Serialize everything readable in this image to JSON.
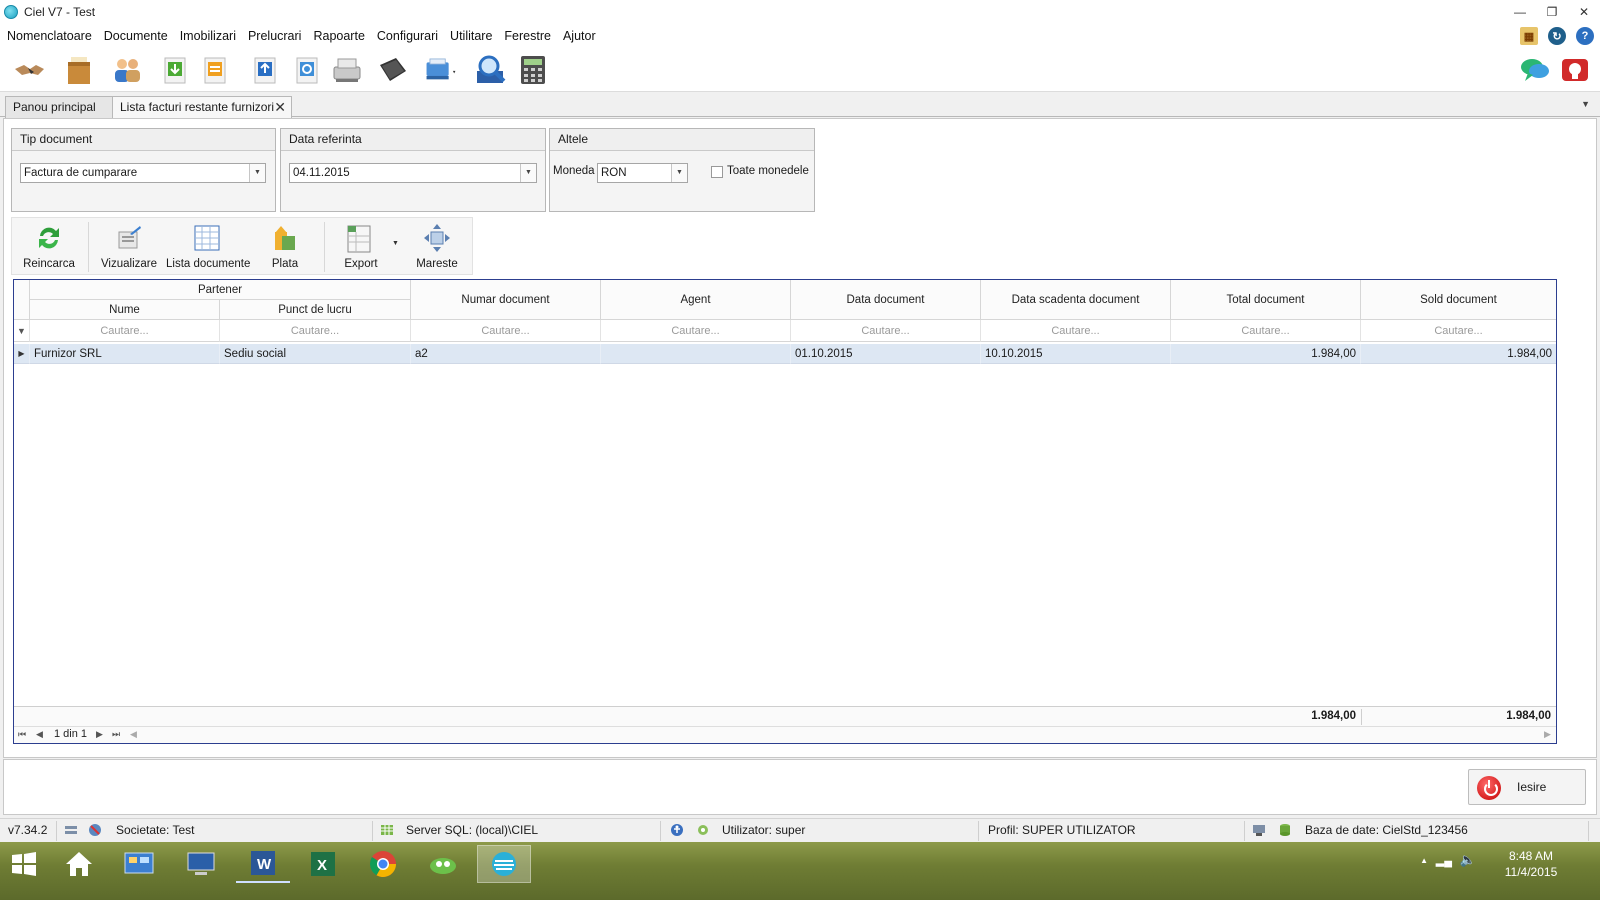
{
  "window": {
    "title": "Ciel V7 - Test"
  },
  "menu": [
    "Nomenclatoare",
    "Documente",
    "Imobilizari",
    "Prelucrari",
    "Rapoarte",
    "Configurari",
    "Utilitare",
    "Ferestre",
    "Ajutor"
  ],
  "tabs": [
    {
      "label": "Panou principal",
      "active": false
    },
    {
      "label": "Lista facturi restante furnizori",
      "active": true
    }
  ],
  "filters": {
    "tip_document": {
      "title": "Tip document",
      "value": "Factura de cumparare"
    },
    "data_referinta": {
      "title": "Data referinta",
      "value": "04.11.2015"
    },
    "altele": {
      "title": "Altele",
      "moneda_label": "Moneda",
      "moneda_value": "RON",
      "toate_label": "Toate monedele",
      "toate_checked": false
    }
  },
  "actions": {
    "reincarca": "Reincarca",
    "vizualizare": "Vizualizare",
    "lista_documente": "Lista documente",
    "plata": "Plata",
    "export": "Export",
    "mareste": "Mareste"
  },
  "grid": {
    "group_header": "Partener",
    "columns": {
      "nume": "Nume",
      "punct": "Punct de lucru",
      "numar": "Numar document",
      "agent": "Agent",
      "data": "Data document",
      "scadenta": "Data scadenta document",
      "total": "Total document",
      "sold": "Sold document"
    },
    "filter_placeholder": "Cautare...",
    "row": {
      "nume": "Furnizor SRL",
      "punct": "Sediu social",
      "numar": "a2",
      "agent": "",
      "data": "01.10.2015",
      "scadenta": "10.10.2015",
      "total": "1.984,00",
      "sold": "1.984,00"
    },
    "totals": {
      "total": "1.984,00",
      "sold": "1.984,00"
    },
    "pager": "1 din 1"
  },
  "exit_label": "Iesire",
  "status": {
    "version": "v7.34.2",
    "societate": "Societate: Test",
    "server": "Server SQL: (local)\\CIEL",
    "utilizator": "Utilizator: super",
    "profil": "Profil: SUPER UTILIZATOR",
    "baza": "Baza de date: CielStd_123456"
  },
  "clock": {
    "time": "8:48 AM",
    "date": "11/4/2015"
  },
  "colors": {
    "accent": "#2c3e8f",
    "row_selected": "#dde7f3",
    "taskbar": "#6f7d34"
  }
}
